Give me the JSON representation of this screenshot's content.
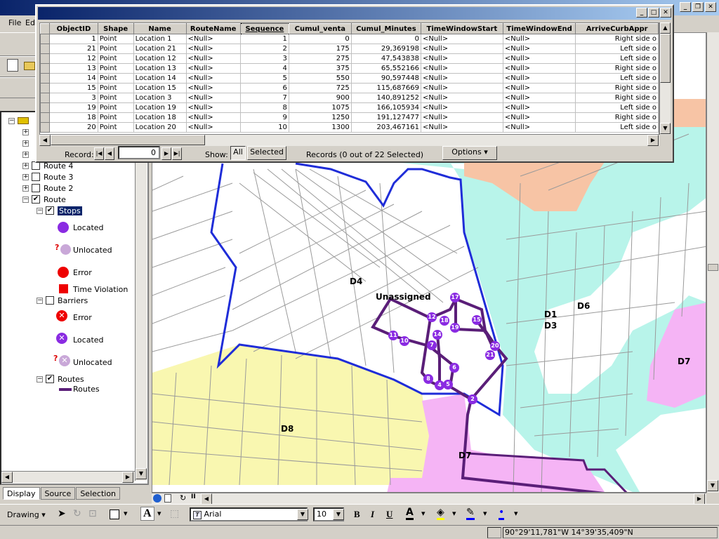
{
  "menu": {
    "file": "File",
    "edit": "Ed"
  },
  "toc": {
    "layers": [
      {
        "label": "Route 4"
      },
      {
        "label": "Route 3"
      },
      {
        "label": "Route 2"
      },
      {
        "label": "Route"
      }
    ],
    "stops_label": "Stops",
    "stops_items": [
      "Located",
      "Unlocated",
      "Error",
      "Time Violation"
    ],
    "barriers_label": "Barriers",
    "barriers_items": [
      "Error",
      "Located",
      "Unlocated"
    ],
    "routes_label": "Routes",
    "routes_item": "Routes",
    "question_mark": "?",
    "tabs": [
      "Display",
      "Source",
      "Selection"
    ]
  },
  "table_window": {
    "columns": [
      "ObjectID",
      "Shape",
      "Name",
      "RouteName",
      "Sequence",
      "Cumul_venta",
      "Cumul_Minutes",
      "TimeWindowStart",
      "TimeWindowEnd",
      "ArriveCurbAppr"
    ],
    "rows": [
      [
        "1",
        "Point",
        "Location 1",
        "<Null>",
        "1",
        "0",
        "0",
        "<Null>",
        "<Null>",
        "Right side o"
      ],
      [
        "21",
        "Point",
        "Location 21",
        "<Null>",
        "2",
        "175",
        "29,369198",
        "<Null>",
        "<Null>",
        "Left side o"
      ],
      [
        "12",
        "Point",
        "Location 12",
        "<Null>",
        "3",
        "275",
        "47,543838",
        "<Null>",
        "<Null>",
        "Left side o"
      ],
      [
        "13",
        "Point",
        "Location 13",
        "<Null>",
        "4",
        "375",
        "65,552166",
        "<Null>",
        "<Null>",
        "Right side o"
      ],
      [
        "14",
        "Point",
        "Location 14",
        "<Null>",
        "5",
        "550",
        "90,597448",
        "<Null>",
        "<Null>",
        "Left side o"
      ],
      [
        "15",
        "Point",
        "Location 15",
        "<Null>",
        "6",
        "725",
        "115,687669",
        "<Null>",
        "<Null>",
        "Right side o"
      ],
      [
        "3",
        "Point",
        "Location 3",
        "<Null>",
        "7",
        "900",
        "140,891252",
        "<Null>",
        "<Null>",
        "Right side o"
      ],
      [
        "19",
        "Point",
        "Location 19",
        "<Null>",
        "8",
        "1075",
        "166,105934",
        "<Null>",
        "<Null>",
        "Left side o"
      ],
      [
        "18",
        "Point",
        "Location 18",
        "<Null>",
        "9",
        "1250",
        "191,127477",
        "<Null>",
        "<Null>",
        "Right side o"
      ],
      [
        "20",
        "Point",
        "Location 20",
        "<Null>",
        "10",
        "1300",
        "203,467161",
        "<Null>",
        "<Null>",
        "Left side o"
      ]
    ],
    "record_label": "Record:",
    "record_value": "0",
    "show_label": "Show:",
    "all_label": "All",
    "selected_label": "Selected",
    "records_status": "Records (0 out of 22 Selected)",
    "options_label": "Options"
  },
  "map": {
    "zone_labels": [
      "D4",
      "Unassigned",
      "D1",
      "D3",
      "D6",
      "D7",
      "D8",
      "D7"
    ],
    "stop_numbers": [
      "17",
      "12",
      "18",
      "15",
      "14",
      "19",
      "11",
      "10",
      "7",
      "20",
      "21",
      "6",
      "8",
      "4",
      "5",
      "2"
    ]
  },
  "drawing": {
    "drawing_label": "Drawing",
    "font_name": "Arial",
    "font_size": "10",
    "bold": "B",
    "italic": "I",
    "underline": "U",
    "font_color_letter": "A"
  },
  "status": {
    "coordinates": "90°29'11,781\"W  14°39'35,409\"N"
  }
}
